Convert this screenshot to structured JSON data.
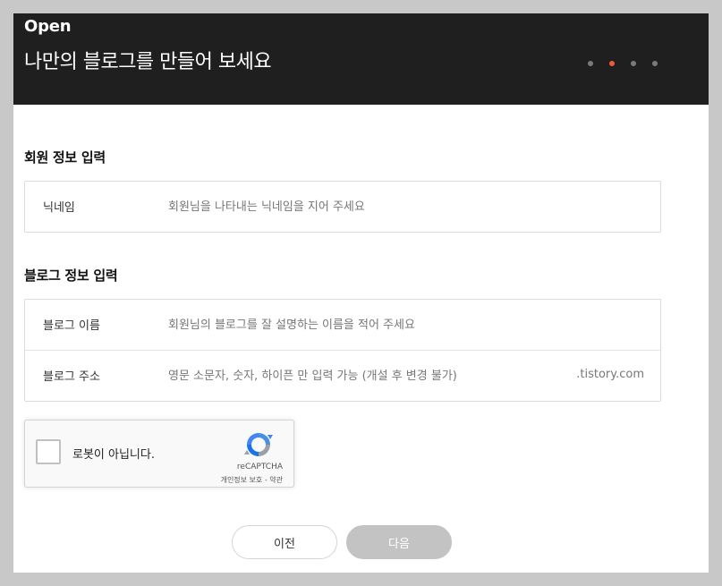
{
  "header": {
    "brand": "Open",
    "headline": "나만의 블로그를 만들어 보세요",
    "step_indicator": {
      "total": 4,
      "current": 2
    },
    "colors": {
      "background": "#1f1f1f",
      "active_dot": "#ef5a3b",
      "inactive_dot": "#7a7a7a"
    }
  },
  "member_section": {
    "title": "회원 정보 입력",
    "nickname": {
      "label": "닉네임",
      "value": "",
      "placeholder": "회원님을 나타내는 닉네임을 지어 주세요"
    }
  },
  "blog_section": {
    "title": "블로그 정보 입력",
    "blog_name": {
      "label": "블로그 이름",
      "value": "",
      "placeholder": "회원님의 블로그를 잘 설명하는 이름을 적어 주세요"
    },
    "blog_address": {
      "label": "블로그 주소",
      "value": "",
      "placeholder": "영문 소문자, 숫자, 하이픈 만 입력 가능 (개설 후 변경 불가)",
      "suffix": ".tistory.com"
    }
  },
  "recaptcha": {
    "checkbox_label": "로봇이 아닙니다.",
    "brand": "reCAPTCHA",
    "privacy_link": "개인정보 보호",
    "separator": " - ",
    "terms_link": "약관"
  },
  "buttons": {
    "prev_label": "이전",
    "next_label": "다음"
  }
}
